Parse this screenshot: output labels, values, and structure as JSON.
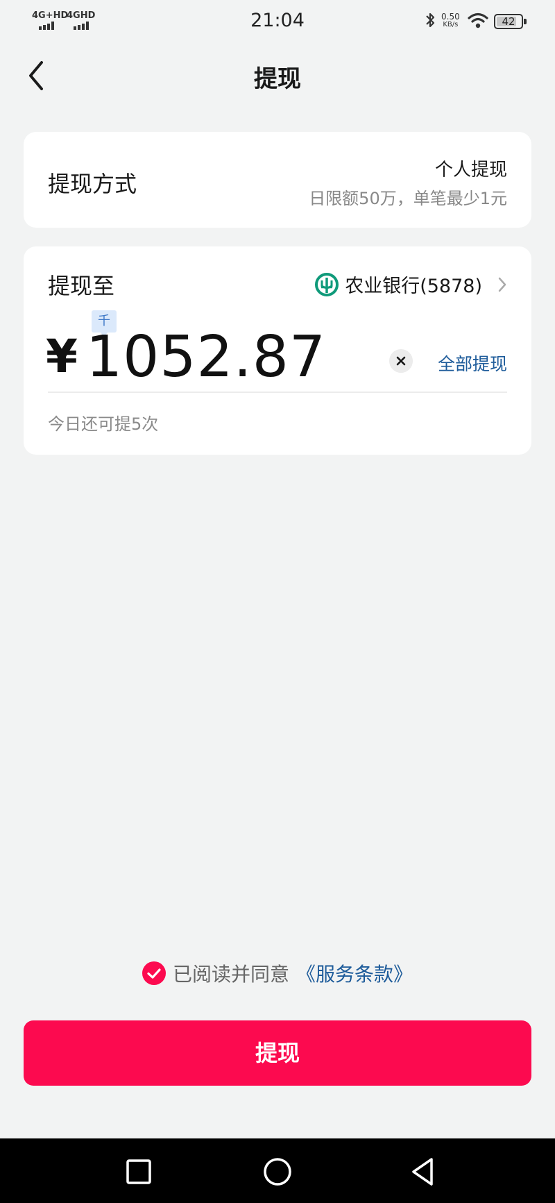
{
  "status_bar": {
    "network_1": "4G+HD",
    "network_2": "4GHD",
    "time": "21:04",
    "speed_value": "0.50",
    "speed_unit": "KB/s",
    "battery": "42"
  },
  "header": {
    "title": "提现",
    "back_icon": "chevron-left-icon"
  },
  "method_card": {
    "label": "提现方式",
    "type": "个人提现",
    "limit_text": "日限额50万，单笔最少1元"
  },
  "withdraw_card": {
    "to_label": "提现至",
    "bank_icon": "abc-bank-icon",
    "bank_name": "农业银行(5878)",
    "unit_hint": "千",
    "currency_symbol": "¥",
    "amount": "1052.87",
    "withdraw_all": "全部提现",
    "remaining_text": "今日还可提5次"
  },
  "agreement": {
    "checked": true,
    "text": "已阅读并同意",
    "link": "《服务条款》"
  },
  "submit_button": "提现",
  "colors": {
    "accent": "#fc0a4f",
    "link": "#1d5b9a",
    "bank_green": "#0f9a7a",
    "background": "#f2f3f3"
  }
}
